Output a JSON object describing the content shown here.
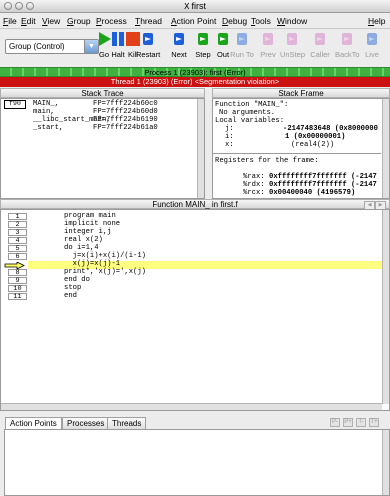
{
  "window": {
    "title": "first",
    "title_icon": "x11-icon"
  },
  "menu": [
    "File",
    "Edit",
    "View",
    "Group",
    "Process",
    "Thread",
    "Action Point",
    "Debug",
    "Tools",
    "Window",
    "Help"
  ],
  "toolbar": {
    "group_select": "Group (Control)",
    "buttons": [
      {
        "label": "Go",
        "icon": "play-icon",
        "color": "#1aa51a",
        "enabled": true
      },
      {
        "label": "Halt",
        "icon": "pause-icon",
        "color": "#1c5fd6",
        "enabled": true
      },
      {
        "label": "Kill",
        "icon": "stop-icon",
        "color": "#e0401a",
        "enabled": true
      },
      {
        "label": "Restart",
        "icon": "restart-icon",
        "color": "#1c5fd6",
        "enabled": true
      },
      {
        "label": "Next",
        "icon": "next-icon",
        "color": "#1c5fd6",
        "enabled": true
      },
      {
        "label": "Step",
        "icon": "step-icon",
        "color": "#1aa51a",
        "enabled": true
      },
      {
        "label": "Out",
        "icon": "out-icon",
        "color": "#1aa51a",
        "enabled": true
      },
      {
        "label": "Run To",
        "icon": "runto-icon",
        "color": "#1c5fd6",
        "enabled": false
      },
      {
        "label": "Prev",
        "icon": "prev-icon",
        "color": "#d070c0",
        "enabled": false
      },
      {
        "label": "UnStep",
        "icon": "unstep-icon",
        "color": "#d070c0",
        "enabled": false
      },
      {
        "label": "Caller",
        "icon": "caller-icon",
        "color": "#d070c0",
        "enabled": false
      },
      {
        "label": "BackTo",
        "icon": "backto-icon",
        "color": "#d070c0",
        "enabled": false
      },
      {
        "label": "Live",
        "icon": "live-icon",
        "color": "#1c5fd6",
        "enabled": false
      }
    ]
  },
  "process_bar": "Process 1 (23903): first (Error)",
  "thread_bar": "Thread 1 (23903) (Error) <Segmentation violation>",
  "stack_trace": {
    "title": "Stack Trace",
    "language_tag": "f90",
    "frames": [
      {
        "fn": "MAIN_,",
        "fp": "FP=7fff224b60c0"
      },
      {
        "fn": "main,",
        "fp": "FP=7fff224b60d0"
      },
      {
        "fn": "__libc_start_main,",
        "fp": "FP=7fff224b6190"
      },
      {
        "fn": "_start,",
        "fp": "FP=7fff224b61a0"
      }
    ]
  },
  "stack_frame": {
    "title": "Stack Frame",
    "function_line": "Function \"MAIN_\":",
    "no_args": "No arguments.",
    "locals_label": "Local variables:",
    "locals": [
      {
        "name": "j:",
        "value": "-2147483648 (0x8000000"
      },
      {
        "name": "i:",
        "value": "1 (0x00000001)"
      },
      {
        "name": "x:",
        "value": "(real4(2))"
      }
    ],
    "registers_label": "Registers for the frame:",
    "registers": [
      {
        "name": "%rax:",
        "value": "0xffffffff7fffffff (-2147"
      },
      {
        "name": "%rdx:",
        "value": "0xffffffff7fffffff (-2147"
      },
      {
        "name": "%rcx:",
        "value": "0x00400040 (4196579)"
      }
    ]
  },
  "source": {
    "title": "Function MAIN_ in first.f",
    "current_line": 7,
    "lines": [
      {
        "n": "1",
        "code": "program main"
      },
      {
        "n": "2",
        "code": "implicit none"
      },
      {
        "n": "3",
        "code": "integer i,j"
      },
      {
        "n": "4",
        "code": "real x(2)"
      },
      {
        "n": "5",
        "code": "do i=1,4"
      },
      {
        "n": "6",
        "code": "  j=x(i)+x(i)/(i-1)"
      },
      {
        "n": "",
        "code": "  x(j)=x(j)-1"
      },
      {
        "n": "8",
        "code": "print*,'x(j)=',x(j)"
      },
      {
        "n": "9",
        "code": "end do"
      },
      {
        "n": "10",
        "code": "stop"
      },
      {
        "n": "11",
        "code": "end"
      }
    ]
  },
  "bottom_tabs": [
    "Action Points",
    "Processes",
    "Threads"
  ],
  "bottom_nav": [
    "P-",
    "P+",
    "T-",
    "T+"
  ]
}
